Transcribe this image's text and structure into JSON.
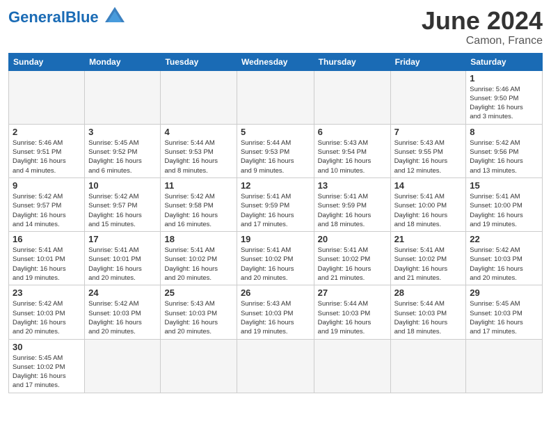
{
  "header": {
    "logo_general": "General",
    "logo_blue": "Blue",
    "month_year": "June 2024",
    "location": "Camon, France"
  },
  "weekdays": [
    "Sunday",
    "Monday",
    "Tuesday",
    "Wednesday",
    "Thursday",
    "Friday",
    "Saturday"
  ],
  "weeks": [
    [
      {
        "day": "",
        "info": ""
      },
      {
        "day": "",
        "info": ""
      },
      {
        "day": "",
        "info": ""
      },
      {
        "day": "",
        "info": ""
      },
      {
        "day": "",
        "info": ""
      },
      {
        "day": "",
        "info": ""
      },
      {
        "day": "1",
        "info": "Sunrise: 5:46 AM\nSunset: 9:50 PM\nDaylight: 16 hours\nand 3 minutes."
      }
    ],
    [
      {
        "day": "2",
        "info": "Sunrise: 5:46 AM\nSunset: 9:51 PM\nDaylight: 16 hours\nand 4 minutes."
      },
      {
        "day": "3",
        "info": "Sunrise: 5:45 AM\nSunset: 9:52 PM\nDaylight: 16 hours\nand 6 minutes."
      },
      {
        "day": "4",
        "info": "Sunrise: 5:44 AM\nSunset: 9:53 PM\nDaylight: 16 hours\nand 8 minutes."
      },
      {
        "day": "5",
        "info": "Sunrise: 5:44 AM\nSunset: 9:53 PM\nDaylight: 16 hours\nand 9 minutes."
      },
      {
        "day": "6",
        "info": "Sunrise: 5:43 AM\nSunset: 9:54 PM\nDaylight: 16 hours\nand 10 minutes."
      },
      {
        "day": "7",
        "info": "Sunrise: 5:43 AM\nSunset: 9:55 PM\nDaylight: 16 hours\nand 12 minutes."
      },
      {
        "day": "8",
        "info": "Sunrise: 5:42 AM\nSunset: 9:56 PM\nDaylight: 16 hours\nand 13 minutes."
      }
    ],
    [
      {
        "day": "9",
        "info": "Sunrise: 5:42 AM\nSunset: 9:57 PM\nDaylight: 16 hours\nand 14 minutes."
      },
      {
        "day": "10",
        "info": "Sunrise: 5:42 AM\nSunset: 9:57 PM\nDaylight: 16 hours\nand 15 minutes."
      },
      {
        "day": "11",
        "info": "Sunrise: 5:42 AM\nSunset: 9:58 PM\nDaylight: 16 hours\nand 16 minutes."
      },
      {
        "day": "12",
        "info": "Sunrise: 5:41 AM\nSunset: 9:59 PM\nDaylight: 16 hours\nand 17 minutes."
      },
      {
        "day": "13",
        "info": "Sunrise: 5:41 AM\nSunset: 9:59 PM\nDaylight: 16 hours\nand 18 minutes."
      },
      {
        "day": "14",
        "info": "Sunrise: 5:41 AM\nSunset: 10:00 PM\nDaylight: 16 hours\nand 18 minutes."
      },
      {
        "day": "15",
        "info": "Sunrise: 5:41 AM\nSunset: 10:00 PM\nDaylight: 16 hours\nand 19 minutes."
      }
    ],
    [
      {
        "day": "16",
        "info": "Sunrise: 5:41 AM\nSunset: 10:01 PM\nDaylight: 16 hours\nand 19 minutes."
      },
      {
        "day": "17",
        "info": "Sunrise: 5:41 AM\nSunset: 10:01 PM\nDaylight: 16 hours\nand 20 minutes."
      },
      {
        "day": "18",
        "info": "Sunrise: 5:41 AM\nSunset: 10:02 PM\nDaylight: 16 hours\nand 20 minutes."
      },
      {
        "day": "19",
        "info": "Sunrise: 5:41 AM\nSunset: 10:02 PM\nDaylight: 16 hours\nand 20 minutes."
      },
      {
        "day": "20",
        "info": "Sunrise: 5:41 AM\nSunset: 10:02 PM\nDaylight: 16 hours\nand 21 minutes."
      },
      {
        "day": "21",
        "info": "Sunrise: 5:41 AM\nSunset: 10:02 PM\nDaylight: 16 hours\nand 21 minutes."
      },
      {
        "day": "22",
        "info": "Sunrise: 5:42 AM\nSunset: 10:03 PM\nDaylight: 16 hours\nand 20 minutes."
      }
    ],
    [
      {
        "day": "23",
        "info": "Sunrise: 5:42 AM\nSunset: 10:03 PM\nDaylight: 16 hours\nand 20 minutes."
      },
      {
        "day": "24",
        "info": "Sunrise: 5:42 AM\nSunset: 10:03 PM\nDaylight: 16 hours\nand 20 minutes."
      },
      {
        "day": "25",
        "info": "Sunrise: 5:43 AM\nSunset: 10:03 PM\nDaylight: 16 hours\nand 20 minutes."
      },
      {
        "day": "26",
        "info": "Sunrise: 5:43 AM\nSunset: 10:03 PM\nDaylight: 16 hours\nand 19 minutes."
      },
      {
        "day": "27",
        "info": "Sunrise: 5:44 AM\nSunset: 10:03 PM\nDaylight: 16 hours\nand 19 minutes."
      },
      {
        "day": "28",
        "info": "Sunrise: 5:44 AM\nSunset: 10:03 PM\nDaylight: 16 hours\nand 18 minutes."
      },
      {
        "day": "29",
        "info": "Sunrise: 5:45 AM\nSunset: 10:03 PM\nDaylight: 16 hours\nand 17 minutes."
      }
    ],
    [
      {
        "day": "30",
        "info": "Sunrise: 5:45 AM\nSunset: 10:02 PM\nDaylight: 16 hours\nand 17 minutes."
      },
      {
        "day": "",
        "info": ""
      },
      {
        "day": "",
        "info": ""
      },
      {
        "day": "",
        "info": ""
      },
      {
        "day": "",
        "info": ""
      },
      {
        "day": "",
        "info": ""
      },
      {
        "day": "",
        "info": ""
      }
    ]
  ]
}
